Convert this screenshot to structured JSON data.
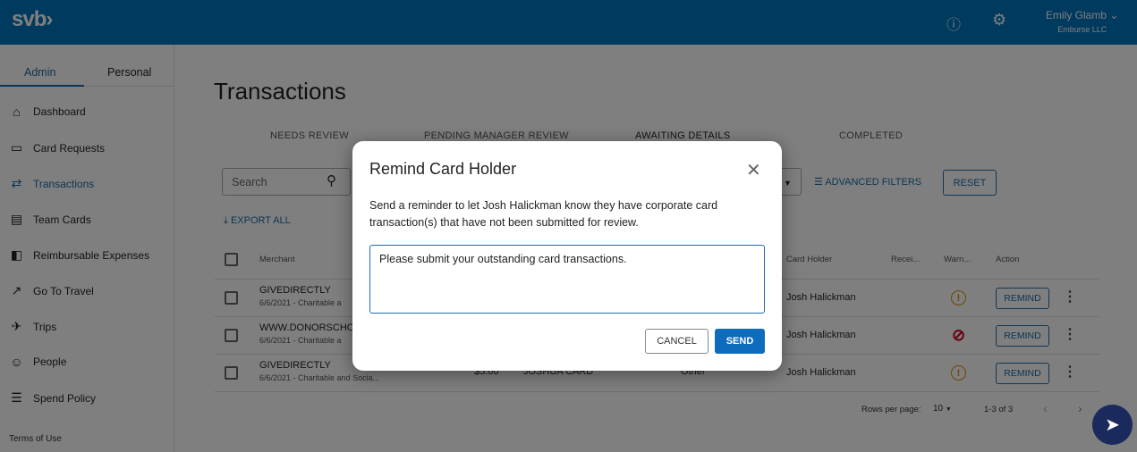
{
  "header": {
    "logo": "svb›",
    "user_name": "Emily Glamb",
    "company": "Emburse LLC",
    "help_icon": "help-circle-icon",
    "settings_icon": "gear-icon"
  },
  "sidebar": {
    "tabs": [
      {
        "label": "Admin",
        "active": true
      },
      {
        "label": "Personal"
      }
    ],
    "items": [
      {
        "label": "Dashboard",
        "icon": "⌂"
      },
      {
        "label": "Card Requests",
        "icon": "▭"
      },
      {
        "label": "Transactions",
        "icon": "⇄",
        "active": true
      },
      {
        "label": "Team Cards",
        "icon": "▤"
      },
      {
        "label": "Reimbursable Expenses",
        "icon": "◧"
      },
      {
        "label": "Go To Travel",
        "icon": "↗"
      },
      {
        "label": "Trips",
        "icon": "✈"
      },
      {
        "label": "People",
        "icon": "☺"
      },
      {
        "label": "Spend Policy",
        "icon": "☰"
      }
    ],
    "footer": "Terms of Use"
  },
  "main": {
    "title": "Transactions",
    "tabs": [
      "NEEDS REVIEW",
      "PENDING MANAGER REVIEW",
      "AWAITING DETAILS",
      "COMPLETED"
    ],
    "search_placeholder": "Search",
    "advanced_filters": "ADVANCED FILTERS",
    "reset": "RESET",
    "export_all": "EXPORT ALL",
    "columns": {
      "merchant": "Merchant",
      "card_holder": "Card Holder",
      "receipt": "Recei...",
      "warnings": "Warn...",
      "action": "Action"
    },
    "rows": [
      {
        "merchant": "GIVEDIRECTLY",
        "sub": "6/6/2021 - Charitable a",
        "card_holder": "Josh Halickman",
        "warning": "warning",
        "action": "REMIND"
      },
      {
        "merchant": "WWW.DONORSCHO",
        "sub": "6/6/2021 - Charitable a",
        "card_holder": "Josh Halickman",
        "warning": "blocked",
        "action": "REMIND"
      },
      {
        "merchant": "GIVEDIRECTLY",
        "sub": "6/6/2021 - Charitable and Socia...",
        "amount": "$5.00",
        "card": "JOSHUA CARD",
        "category": "Other",
        "card_holder": "Josh Halickman",
        "warning": "warning",
        "action": "REMIND"
      }
    ],
    "pagination": {
      "rows_per_page_label": "Rows per page:",
      "rows_per_page": "10",
      "range": "1-3 of 3"
    }
  },
  "modal": {
    "title": "Remind Card Holder",
    "body": "Send a reminder to let Josh Halickman know they have corporate card transaction(s) that have not been submitted for review.",
    "message": "Please submit your outstanding card transactions.",
    "cancel": "CANCEL",
    "send": "SEND"
  },
  "colors": {
    "brand": "#0074bc",
    "accent": "#0f6cbd",
    "warning": "#e08a00",
    "blocked": "#d0021b"
  }
}
